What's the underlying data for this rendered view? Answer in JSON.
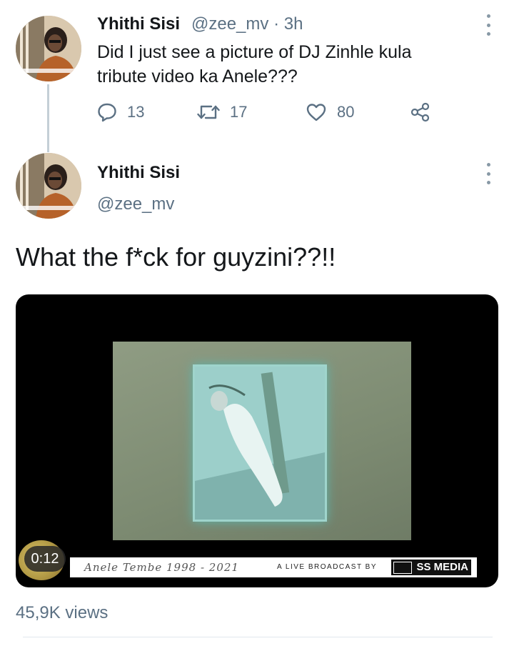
{
  "tweet1": {
    "name": "Yhithi Sisi",
    "handle_time": "@zee_mv · 3h",
    "text_line1": "Did I just see a picture of DJ Zinhle kula",
    "text_line2": "tribute video ka Anele???",
    "replies": "13",
    "retweets": "17",
    "likes": "80",
    "icons": [
      "reply-icon",
      "retweet-icon",
      "like-icon",
      "share-icon",
      "more-icon"
    ]
  },
  "tweet2": {
    "name": "Yhithi Sisi",
    "handle": "@zee_mv",
    "text": "What the f*ck for guyzini??!!",
    "video": {
      "duration": "0:12",
      "banner_script": "Anele Tembe 1998 - 2021",
      "banner_live": "A LIVE BROADCAST BY",
      "banner_logo": "SS MEDIA"
    },
    "views": "45,9K views"
  },
  "colors": {
    "text": "#14171a",
    "secondary": "#5b7083",
    "thread_line": "#c4cfd6"
  }
}
